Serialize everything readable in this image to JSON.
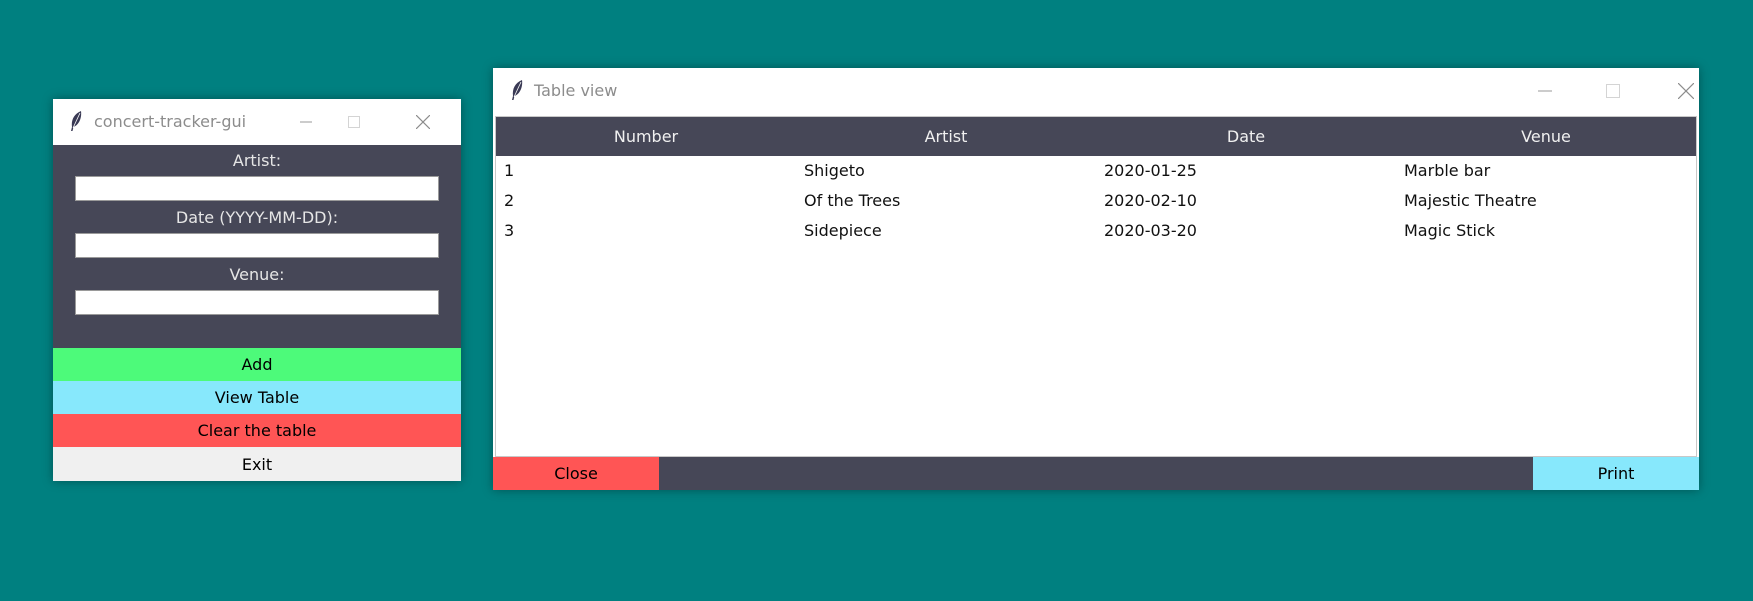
{
  "form_window": {
    "title": "concert-tracker-gui",
    "fields": {
      "artist_label": "Artist:",
      "artist_value": "",
      "date_label": "Date (YYYY-MM-DD):",
      "date_value": "",
      "venue_label": "Venue:",
      "venue_value": ""
    },
    "buttons": {
      "add": "Add",
      "view_table": "View Table",
      "clear_table": "Clear the table",
      "exit": "Exit"
    }
  },
  "table_window": {
    "title": "Table view",
    "columns": [
      "Number",
      "Artist",
      "Date",
      "Venue"
    ],
    "rows": [
      [
        "1",
        "Shigeto",
        "2020-01-25",
        "Marble bar"
      ],
      [
        "2",
        "Of the Trees",
        "2020-02-10",
        "Majestic Theatre"
      ],
      [
        "3",
        "Sidepiece",
        "2020-03-20",
        "Magic Stick"
      ]
    ],
    "buttons": {
      "close": "Close",
      "print": "Print"
    }
  },
  "colors": {
    "desktop": "#008080",
    "panel": "#464757",
    "add": "#4dfa7a",
    "view": "#87e8fc",
    "clear": "#ff5555",
    "exit": "#f0f0f0"
  },
  "icons": [
    "feather-icon",
    "minimize-icon",
    "maximize-icon",
    "close-icon"
  ]
}
